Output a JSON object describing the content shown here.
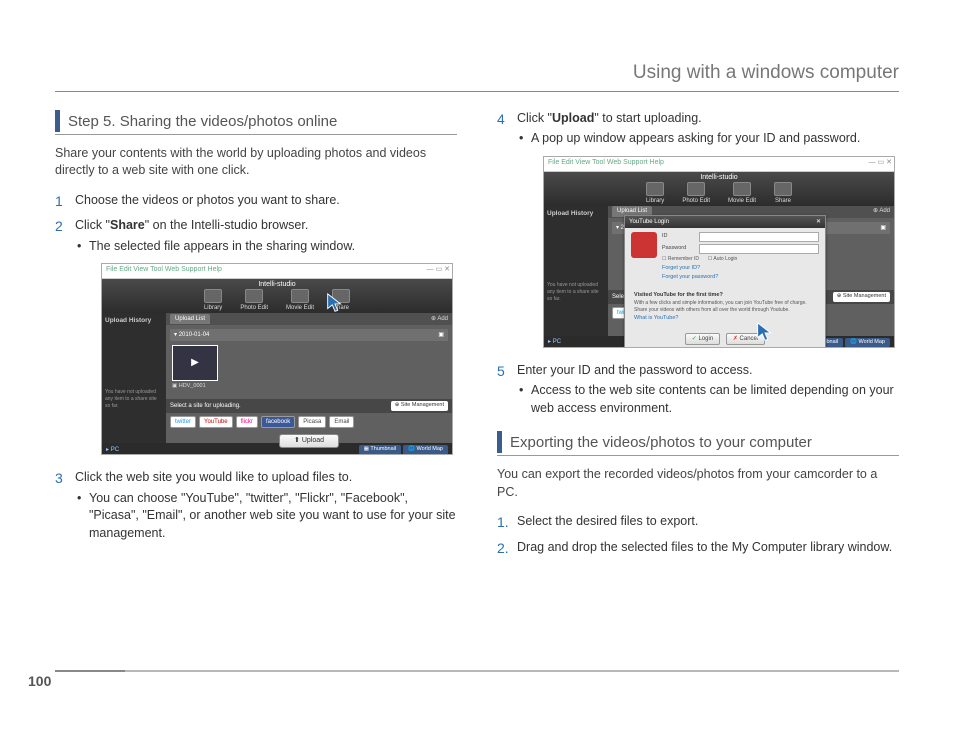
{
  "header": {
    "title": "Using with a windows computer"
  },
  "page_number": "100",
  "left": {
    "section_title": "Step 5. Sharing the videos/photos online",
    "intro": "Share your contents with the world by uploading photos and videos directly to a web site with one click.",
    "step1": {
      "num": "1",
      "text": "Choose the videos or photos you want to share."
    },
    "step2": {
      "num": "2",
      "pre": "Click \"",
      "bold": "Share",
      "post": "\" on the Intelli-studio browser.",
      "sub1": "The selected file appears in the sharing window."
    },
    "step3": {
      "num": "3",
      "text": "Click the web site you would like to upload files to.",
      "sub1": "You can choose \"YouTube\", \"twitter\", \"Flickr\", \"Facebook\", \"Picasa\", \"Email\", or another web site you want to use for your site management."
    }
  },
  "right": {
    "step4": {
      "num": "4",
      "pre": "Click \"",
      "bold": "Upload",
      "post": "\" to start uploading.",
      "sub1": "A pop up window appears asking for your ID and password."
    },
    "step5": {
      "num": "5",
      "text": "Enter your ID and the password to access.",
      "sub1": "Access to the web site contents can be limited depending on your web access environment."
    },
    "section2_title": "Exporting the videos/photos to your computer",
    "section2_intro": "You can export the recorded videos/photos from your camcorder to a PC.",
    "exp1": {
      "num": "1.",
      "text": "Select the desired files to export."
    },
    "exp2": {
      "num": "2.",
      "text": "Drag and drop the selected files to the My Computer library window."
    }
  },
  "shot": {
    "menubar": "File  Edit  View  Tool  Web Support  Help",
    "app_title": "Intelli-studio",
    "tabs": {
      "library": "Library",
      "photo": "Photo Edit",
      "movie": "Movie Edit",
      "share": "Share"
    },
    "left_header": "Upload History",
    "left_note": "You have not uploaded any item to a share site so far.",
    "tab_label": "Upload List",
    "add_label": "Add",
    "date": "2010-01-04",
    "filename": "HDV_0001",
    "select_label": "Select a site for uploading.",
    "site_mgmt": "Site Management",
    "sites": {
      "twitter": "twitter",
      "youtube": "YouTube",
      "flickr": "flickr",
      "facebook": "facebook",
      "picasa": "Picasa",
      "email": "Email"
    },
    "upload_btn": "Upload",
    "footer_pc": "PC",
    "footer_thumb": "Thumbnail",
    "footer_map": "World Map",
    "dialog": {
      "title": "YouTube Login",
      "id_label": "ID",
      "pw_label": "Password",
      "remember": "Remember ID",
      "autologin": "Auto Login",
      "forgot_id": "Forget your ID?",
      "forgot_pw": "Forget your password?",
      "promo_title": "Visited YouTube for the first time?",
      "promo_body": "With a few clicks and simple information, you can join YouTube free of charge. Share your videos with others from all over the world through Youtube.",
      "whatis": "What is YouTube?",
      "login": "Login",
      "cancel": "Cancel"
    }
  }
}
